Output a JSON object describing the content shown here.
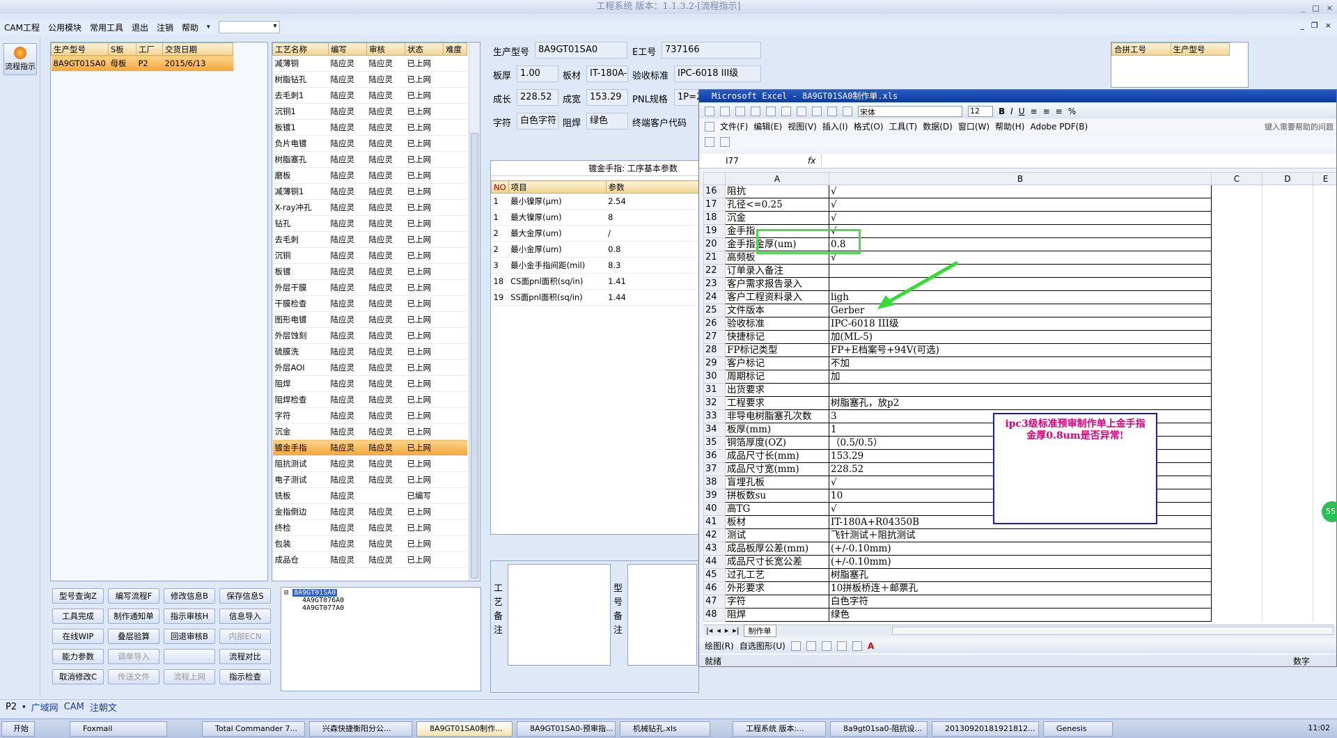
{
  "window": {
    "title": "工程系统  版本：1.1.3.2-[流程指示]",
    "controls": [
      "_",
      "□",
      "×"
    ]
  },
  "menu": {
    "items": [
      "CAM工程",
      "公用模块",
      "常用工具",
      "退出",
      "注销",
      "帮助"
    ],
    "dropdown": ""
  },
  "left_button": {
    "label": "流程指示"
  },
  "orders": {
    "headers": [
      "生产型号",
      "S板",
      "工厂",
      "交货日期"
    ],
    "row": [
      "8A9GT01SA0",
      "母板",
      "P2",
      "2015/6/13"
    ]
  },
  "process": {
    "headers": [
      "工艺名称",
      "编写",
      "审核",
      "状态",
      "难度"
    ],
    "rows": [
      [
        "减薄铜",
        "陆应灵",
        "陆应灵",
        "已上网"
      ],
      [
        "树脂钻孔",
        "陆应灵",
        "陆应灵",
        "已上网"
      ],
      [
        "去毛刺1",
        "陆应灵",
        "陆应灵",
        "已上网"
      ],
      [
        "沉铜1",
        "陆应灵",
        "陆应灵",
        "已上网"
      ],
      [
        "板镀1",
        "陆应灵",
        "陆应灵",
        "已上网"
      ],
      [
        "负片电镀",
        "陆应灵",
        "陆应灵",
        "已上网"
      ],
      [
        "树脂塞孔",
        "陆应灵",
        "陆应灵",
        "已上网"
      ],
      [
        "磨板",
        "陆应灵",
        "陆应灵",
        "已上网"
      ],
      [
        "减薄铜1",
        "陆应灵",
        "陆应灵",
        "已上网"
      ],
      [
        "X-ray冲孔",
        "陆应灵",
        "陆应灵",
        "已上网"
      ],
      [
        "钻孔",
        "陆应灵",
        "陆应灵",
        "已上网"
      ],
      [
        "去毛刺",
        "陆应灵",
        "陆应灵",
        "已上网"
      ],
      [
        "沉铜",
        "陆应灵",
        "陆应灵",
        "已上网"
      ],
      [
        "板镀",
        "陆应灵",
        "陆应灵",
        "已上网"
      ],
      [
        "外层干膜",
        "陆应灵",
        "陆应灵",
        "已上网"
      ],
      [
        "干膜检查",
        "陆应灵",
        "陆应灵",
        "已上网"
      ],
      [
        "图形电镀",
        "陆应灵",
        "陆应灵",
        "已上网"
      ],
      [
        "外层蚀刻",
        "陆应灵",
        "陆应灵",
        "已上网"
      ],
      [
        "硫膜洗",
        "陆应灵",
        "陆应灵",
        "已上网"
      ],
      [
        "外层AOI",
        "陆应灵",
        "陆应灵",
        "已上网"
      ],
      [
        "阻焊",
        "陆应灵",
        "陆应灵",
        "已上网"
      ],
      [
        "阻焊检查",
        "陆应灵",
        "陆应灵",
        "已上网"
      ],
      [
        "字符",
        "陆应灵",
        "陆应灵",
        "已上网"
      ],
      [
        "沉金",
        "陆应灵",
        "陆应灵",
        "已上网"
      ],
      [
        "镀金手指",
        "陆应灵",
        "陆应灵",
        "已上网"
      ],
      [
        "阻抗测试",
        "陆应灵",
        "陆应灵",
        "已上网"
      ],
      [
        "电子测试",
        "陆应灵",
        "陆应灵",
        "已上网"
      ],
      [
        "铣板",
        "陆应灵",
        "",
        "已编写"
      ],
      [
        "金指倒边",
        "陆应灵",
        "陆应灵",
        "已上网"
      ],
      [
        "终检",
        "陆应灵",
        "陆应灵",
        "已上网"
      ],
      [
        "包装",
        "陆应灵",
        "陆应灵",
        "已上网"
      ],
      [
        "成品仓",
        "陆应灵",
        "陆应灵",
        "已上网"
      ]
    ],
    "selected_index": 24
  },
  "buttons": [
    [
      "型号查询Z",
      "编写流程F",
      "修改信息B",
      "保存信息S"
    ],
    [
      "工具完成",
      "制作通知单",
      "指示审核H",
      "信息导入"
    ],
    [
      "在线WIP",
      "叠层验算",
      "回退审核B",
      "内部ECN"
    ],
    [
      "能力参数",
      "调单导入",
      "",
      "流程对比"
    ],
    [
      "取消修改C",
      "传送文件",
      "流程上网",
      "指示检查"
    ]
  ],
  "disabled_buttons": [
    "内部ECN",
    "调单导入",
    "传送文件",
    "流程上网"
  ],
  "tree": {
    "root": "8A9GT01SA0",
    "children": [
      "4A9GT076A0",
      "4A9GT077A0"
    ]
  },
  "info": {
    "labels": {
      "model": "生产型号",
      "e_no": "E工号",
      "thick": "板厚",
      "material": "板材",
      "accept": "验收标准",
      "len": "成长",
      "width": "成宽",
      "pnl": "PNL规格",
      "char": "字符",
      "solder": "阻焊",
      "customer_code": "终端客户代码"
    },
    "values": {
      "model": "8A9GT01SA0",
      "e_no": "737166",
      "thick": "1.00",
      "material": "IT-180A-",
      "accept": "IPC-6018 III级",
      "len": "228.52",
      "width": "153.29",
      "pnl": "1P=2",
      "char": "白色字符",
      "solder": "绿色"
    }
  },
  "merge": {
    "headers": [
      "合拼工号",
      "生产型号"
    ]
  },
  "params": {
    "title": "镀金手指: 工序基本参数",
    "headers": [
      "NO",
      "项目",
      "参数"
    ],
    "rows": [
      [
        "1",
        "最小镍厚(μm)",
        "2.54"
      ],
      [
        "1",
        "最大镍厚(um)",
        "8"
      ],
      [
        "2",
        "最大金厚(um)",
        "/"
      ],
      [
        "2",
        "最小金厚(um)",
        "0.8"
      ],
      [
        "3",
        "最小金手指间距(mil)",
        "8.3"
      ],
      [
        "18",
        "CS面pnl面积(sq/in)",
        "1.41"
      ],
      [
        "19",
        "SS面pnl面积(sq/in)",
        "1.44"
      ]
    ]
  },
  "remarks": {
    "process": "工艺备注",
    "model": "型号备注"
  },
  "excel": {
    "title": "Microsoft Excel - 8A9GT01SA0制作单.xls",
    "menu": [
      "文件(F)",
      "编辑(E)",
      "视图(V)",
      "插入(I)",
      "格式(O)",
      "工具(T)",
      "数据(D)",
      "窗口(W)",
      "帮助(H)",
      "Adobe PDF(B)"
    ],
    "help_hint": "键入需要帮助的问题",
    "font": "宋体",
    "size": "12",
    "cell_ref": "I77",
    "fx": "fx",
    "columns": [
      "A",
      "B",
      "C",
      "D",
      "E"
    ],
    "rows": [
      [
        "16",
        "阻抗",
        "√"
      ],
      [
        "17",
        "孔径<=0.25",
        "√"
      ],
      [
        "18",
        "沉金",
        "√"
      ],
      [
        "19",
        "金手指",
        "√"
      ],
      [
        "20",
        "金手指金厚(um)",
        "0.8"
      ],
      [
        "21",
        "高频板",
        "√"
      ],
      [
        "22",
        "订单录入备注",
        ""
      ],
      [
        "23",
        "客户需求报告录入",
        ""
      ],
      [
        "24",
        "客户工程资料录入",
        "ligh"
      ],
      [
        "25",
        "文件版本",
        "Gerber"
      ],
      [
        "26",
        "验收标准",
        "IPC-6018 III级"
      ],
      [
        "27",
        "快捷标记",
        "加(ML-5)"
      ],
      [
        "28",
        "FP标记类型",
        "FP+E档案号+94V(可选)"
      ],
      [
        "29",
        "客户标记",
        "不加"
      ],
      [
        "30",
        "周期标记",
        "加"
      ],
      [
        "31",
        "出货要求",
        ""
      ],
      [
        "32",
        "工程要求",
        "树脂塞孔，放p2"
      ],
      [
        "33",
        "非导电树脂塞孔次数",
        "3"
      ],
      [
        "34",
        "板厚(mm)",
        "1"
      ],
      [
        "35",
        "铜箔厚度(OZ)",
        "（0.5/0.5）"
      ],
      [
        "36",
        "成品尺寸长(mm)",
        "153.29"
      ],
      [
        "37",
        "成品尺寸宽(mm)",
        "228.52"
      ],
      [
        "38",
        "盲埋孔板",
        "√"
      ],
      [
        "39",
        "拼板数su",
        "10"
      ],
      [
        "40",
        "高TG",
        "√"
      ],
      [
        "41",
        "板材",
        "IT-180A+R04350B"
      ],
      [
        "42",
        "测试",
        "飞针测试＋阻抗测试"
      ],
      [
        "43",
        "成品板厚公差(mm)",
        "(+/-0.10mm)"
      ],
      [
        "44",
        "成品尺寸长宽公差",
        "(+/-0.10mm)"
      ],
      [
        "45",
        "过孔工艺",
        "树脂塞孔"
      ],
      [
        "46",
        "外形要求",
        "10拼板桥连＋邮票孔"
      ],
      [
        "47",
        "字符",
        "白色字符"
      ],
      [
        "48",
        "阻焊",
        "绿色"
      ]
    ],
    "sheet_tab": "制作单",
    "draw_label": "绘图(R)",
    "autoshape": "自选图形(U)",
    "status_left": "就绪",
    "status_right": "数字",
    "annotation": "ipc3级标准预审制作单上金手指金厚0.8um是否异常!",
    "annotation_color": "#e0007a",
    "highlight_color": "#3ad13a"
  },
  "bottom_tabs": {
    "site": "P2",
    "tabs": [
      "广域网",
      "CAM",
      "注朝文"
    ]
  },
  "taskbar": {
    "start": "开始",
    "items": [
      "Foxmail",
      "Total Commander 7...",
      "兴森快捷衡阳分公...",
      "8A9GT01SA0制作...",
      "8A9GT01SA0-预审指...",
      "机械钻孔.xls",
      "工程系统  版本:...",
      "8a9gt01sa0-阻抗设...",
      "20130920181921812...",
      "Genesis"
    ],
    "active_index": 3,
    "clock": "11:02"
  },
  "badge": "55"
}
